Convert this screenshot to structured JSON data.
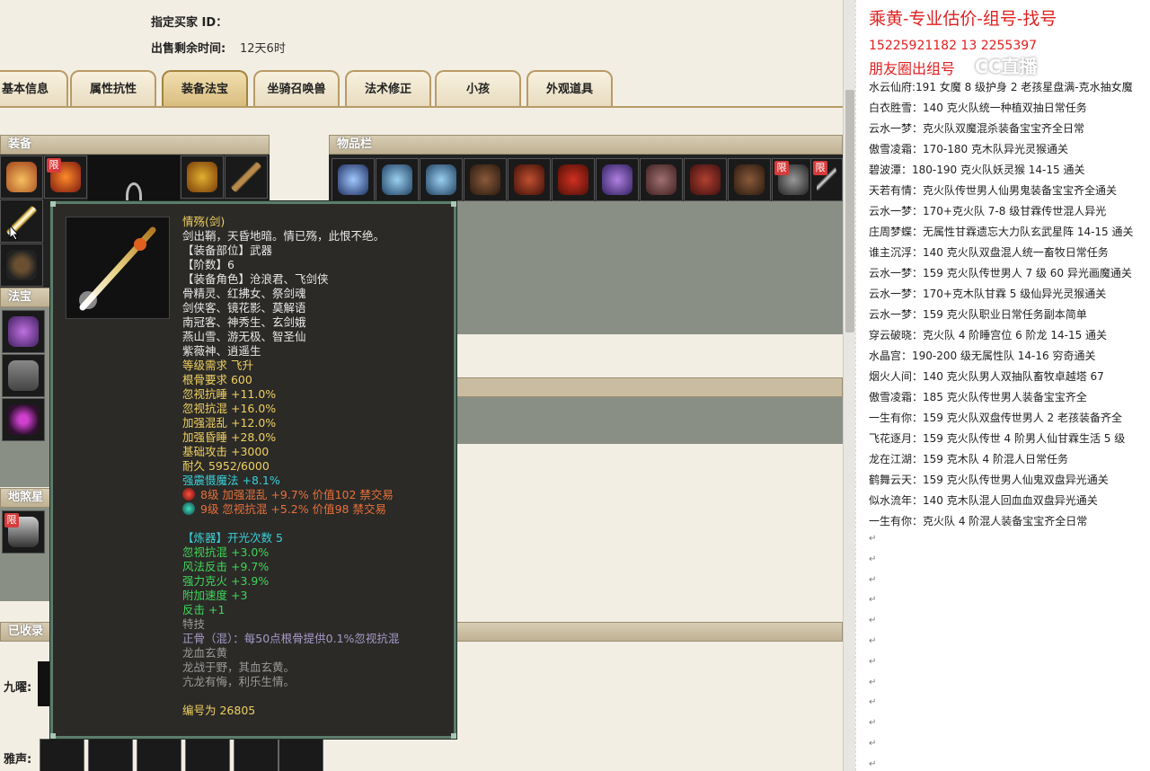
{
  "header": {
    "buyer_label": "指定买家 ID：",
    "remaining_label": "出售剩余时间:",
    "remaining_value": "12天6时"
  },
  "tabs": [
    {
      "label": "基本信息"
    },
    {
      "label": "属性抗性"
    },
    {
      "label": "装备法宝"
    },
    {
      "label": "坐骑召唤兽"
    },
    {
      "label": "法术修正"
    },
    {
      "label": "小孩"
    },
    {
      "label": "外观道具"
    }
  ],
  "sections": {
    "equip": "装备",
    "items": "物品栏",
    "fabao": "法宝",
    "disha": "地煞星",
    "collected": "已收录",
    "jiuyao": "九曜:",
    "yasheng": "雅声:"
  },
  "badge": "限",
  "tooltip": {
    "name": "情殇(剑)",
    "desc": "剑出鞘，天昏地暗。情已殇，此恨不绝。",
    "slot": "【装备部位】武器",
    "tier": "【阶数】6",
    "roles": [
      "【装备角色】沧浪君、飞剑侠",
      "骨精灵、红拂女、祭剑魂",
      "剑侠客、镜花影、莫解语",
      "南冠客、神秀生、玄剑娥",
      "燕山雪、游无极、智圣仙",
      "紫薇神、逍遥生"
    ],
    "yellow_stats": [
      "等级需求 飞升",
      "根骨要求 600",
      "忽视抗睡 +11.0%",
      "忽视抗混 +16.0%",
      "加强混乱 +12.0%",
      "加强昏睡 +28.0%",
      "基础攻击 +3000",
      "耐久 5952/6000"
    ],
    "cyan_stat": "强震慑魔法 +8.1%",
    "gems": [
      "8级 加强混乱 +9.7% 价值102 禁交易",
      "9级 忽视抗混 +5.2% 价值98 禁交易"
    ],
    "refine_head": "【炼器】开光次数 5",
    "green_stats": [
      "忽视抗混 +3.0%",
      "风法反击 +9.7%",
      "强力克火 +3.9%",
      "附加速度 +3",
      "反击 +1"
    ],
    "special": [
      "特技",
      "正骨（混）：每50点根骨提供0.1%忽视抗混",
      "龙血玄黄",
      "龙战于野，其血玄黄。",
      "亢龙有悔，利乐生情。"
    ],
    "serial": "编号为 26805"
  },
  "right_panel": {
    "title": "乘黄-专业估价-组号-找号",
    "phones": "15225921182   13 2255397",
    "subtitle": "朋友圈出组号",
    "lines": [
      "水云仙府:191 女魔 8 级护身 2 老孩星盘满-克水抽女魔",
      "白衣胜雪：140 克火队统一种植双抽日常任务",
      "云水一梦：克火队双魔混杀装备宝宝齐全日常",
      "傲雪凌霜：170-180 克木队异光灵猴通关",
      "碧波潭：180-190 克火队妖灵猴 14-15 通关",
      "天若有情：克火队传世男人仙男鬼装备宝宝齐全通关",
      "云水一梦：170+克火队 7-8 级甘霖传世混人异光",
      "庄周梦蝶：无属性甘霖遗忘大力队玄武星阵 14-15 通关",
      "谁主沉浮：140 克火队双盘混人统一畜牧日常任务",
      "云水一梦：159 克火队传世男人 7 级 60 异光画魔通关",
      "云水一梦：170+克木队甘霖 5 级仙异光灵猴通关",
      "云水一梦：159 克火队职业日常任务副本简单",
      "穿云破晓：克火队 4 阶睡宫位 6 阶龙 14-15 通关",
      "水晶宫：190-200 级无属性队 14-16 穷奇通关",
      "烟火人间：140 克火队男人双抽队畜牧卓越塔 67",
      "傲雪凌霜：185 克火队传世男人装备宝宝齐全",
      "一生有你：159 克火队双盘传世男人 2 老孩装备齐全",
      "飞花逐月：159 克火队传世 4 阶男人仙甘霖生活 5 级",
      "龙在江湖：159 克木队 4 阶混人日常任务",
      "鹤舞云天：159 克火队传世男人仙鬼双盘异光通关",
      "似水流年：140 克木队混人回血血双盘异光通关",
      "一生有你：克火队 4 阶混人装备宝宝齐全日常"
    ],
    "watermark": "CC直播"
  },
  "colors": {
    "accent_red": "#e02020",
    "tooltip_bg": "#2b2a27",
    "tooltip_border": "#5d7c6b",
    "stat_yellow": "#f0d060",
    "stat_green": "#3fd65a",
    "stat_cyan": "#39d0d8",
    "gem_orange": "#e8703a"
  }
}
